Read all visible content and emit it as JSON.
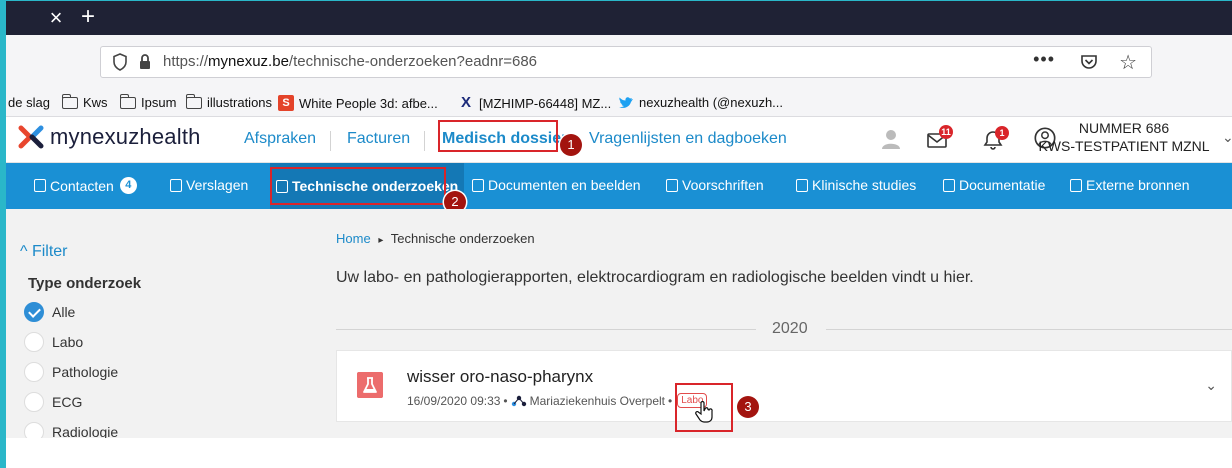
{
  "browser": {
    "close_glyph": "×",
    "new_tab_glyph": "+",
    "url_prefix": "https://",
    "url_host": "mynexuz.be",
    "url_path": "/technische-onderzoeken?eadnr=686",
    "url_more": "•••"
  },
  "bookmarks": [
    {
      "label": "de slag",
      "icon": "none"
    },
    {
      "label": "Kws",
      "icon": "folder-icon"
    },
    {
      "label": "Ipsum",
      "icon": "folder-icon"
    },
    {
      "label": "illustrations",
      "icon": "folder-icon"
    },
    {
      "label": "White People 3d: afbe...",
      "icon": "red-app-icon"
    },
    {
      "label": "[MZHIMP-66448] MZ...",
      "icon": "jira-x-icon"
    },
    {
      "label": "nexuzhealth (@nexuzh...",
      "icon": "twitter-bird-icon"
    }
  ],
  "header": {
    "logo_text": "mynexuzhealth",
    "nav": [
      "Afspraken",
      "Facturen",
      "Medisch dossier",
      "Vragenlijsten en dagboeken"
    ],
    "mail_badge": "11",
    "bell_badge": "1",
    "user_line1": "NUMMER 686",
    "user_line2": "KWS-TESTPATIENT MZNL",
    "user_chevron": "⌄"
  },
  "steps": [
    "1",
    "2",
    "3"
  ],
  "tabs": {
    "contacten": {
      "label": "Contacten",
      "count": "4"
    },
    "verslagen": "Verslagen",
    "technische": "Technische onderzoeken",
    "documenten": "Documenten en beelden",
    "voorschriften": "Voorschriften",
    "klinische": "Klinische studies",
    "documentatie": "Documentatie",
    "externe": "Externe bronnen"
  },
  "sidebar": {
    "filter_toggle": "^ Filter",
    "filter_title": "Type onderzoek",
    "options": [
      "Alle",
      "Labo",
      "Pathologie",
      "ECG",
      "Radiologie"
    ],
    "selected": "Alle"
  },
  "breadcrumb": {
    "home": "Home",
    "sep": "▸",
    "current": "Technische onderzoeken"
  },
  "intro": "Uw labo- en pathologierapporten, elektrocardiogram en radiologische beelden vindt u hier.",
  "year": "2020",
  "card": {
    "title": "wisser oro-naso-pharynx",
    "datetime": "16/09/2020 09:33",
    "dot": "•",
    "hospital": "Mariaziekenhuis Overpelt",
    "tag": "Labo",
    "chevron": "⌄"
  },
  "colors": {
    "primary": "#1a90d4",
    "accent_red": "#d9252a",
    "step_red": "#a3140f",
    "lab_icon": "#ec6c6c"
  }
}
